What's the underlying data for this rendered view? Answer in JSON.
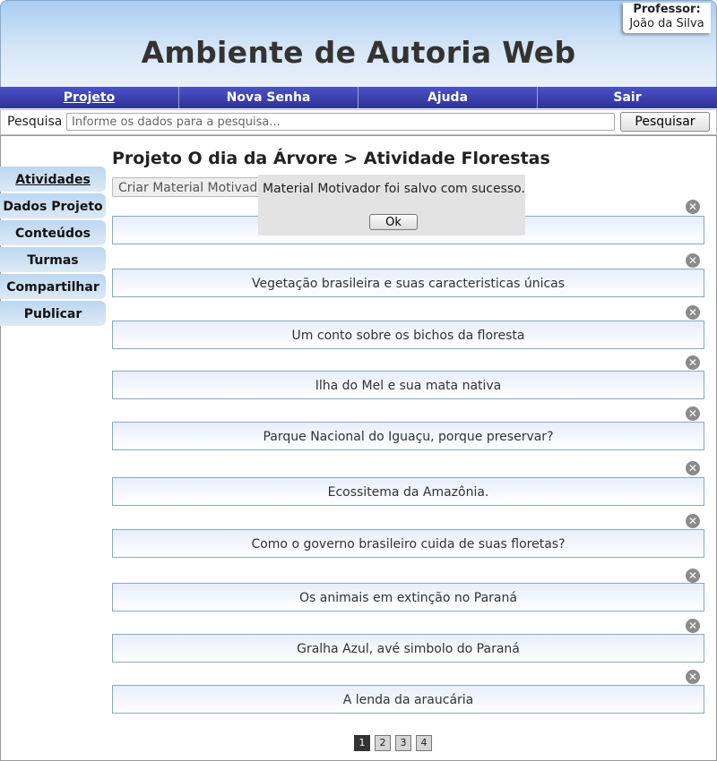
{
  "header": {
    "title": "Ambiente de Autoria Web",
    "professor_label": "Professor:",
    "professor_name": "João da Silva"
  },
  "nav": [
    "Projeto",
    "Nova Senha",
    "Ajuda",
    "Sair"
  ],
  "search": {
    "label": "Pesquisa",
    "placeholder": "Informe os dados para a pesquisa...",
    "button": "Pesquisar"
  },
  "sidebar": [
    "Atividades",
    "Dados Projeto",
    "Conteúdos",
    "Turmas",
    "Compartilhar",
    "Publicar"
  ],
  "breadcrumb": "Projeto O dia da Árvore > Atividade Florestas",
  "create_button": "Criar Material Motivador",
  "items": [
    "",
    "Vegetação brasileira e suas caracteristicas únicas",
    "Um conto sobre os bichos da floresta",
    "Ilha do Mel e sua mata nativa",
    "Parque Nacional do Iguaçu, porque preservar?",
    "Ecossitema da Amazônia.",
    "Como o governo brasileiro cuida de suas floretas?",
    "Os animais em extinção no Paraná",
    "Gralha Azul, avé simbolo do Paraná",
    "A lenda da araucária"
  ],
  "dialog": {
    "message": "Material Motivador foi salvo com sucesso.",
    "ok": "Ok"
  },
  "pagination": [
    "1",
    "2",
    "3",
    "4"
  ]
}
